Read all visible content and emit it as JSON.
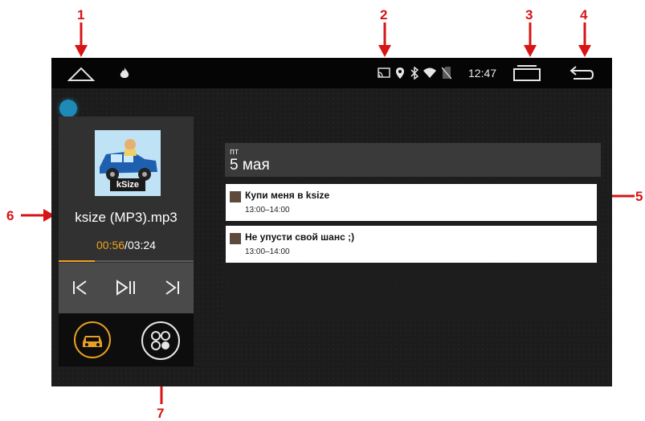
{
  "annotations": [
    "1",
    "2",
    "3",
    "4",
    "5",
    "6",
    "7"
  ],
  "status_bar": {
    "time": "12:47",
    "icons": [
      "home-icon",
      "fire-icon",
      "cast-icon",
      "location-icon",
      "bluetooth-icon",
      "wifi-icon",
      "no-sim-icon",
      "recent-apps-icon",
      "back-icon"
    ]
  },
  "media_player": {
    "album_label": "kSize",
    "track_title": "ksize (MP3).mp3",
    "current_time": "00:56",
    "separator": "/",
    "total_time": "03:24",
    "progress": 0.27,
    "accent": "#f0a020"
  },
  "calendar": {
    "weekday": "пт",
    "date": "5 мая",
    "events": [
      {
        "title": "Купи меня в ksize",
        "time": "13:00–14:00"
      },
      {
        "title": "Не упусти свой шанс ;)",
        "time": "13:00–14:00"
      }
    ]
  }
}
